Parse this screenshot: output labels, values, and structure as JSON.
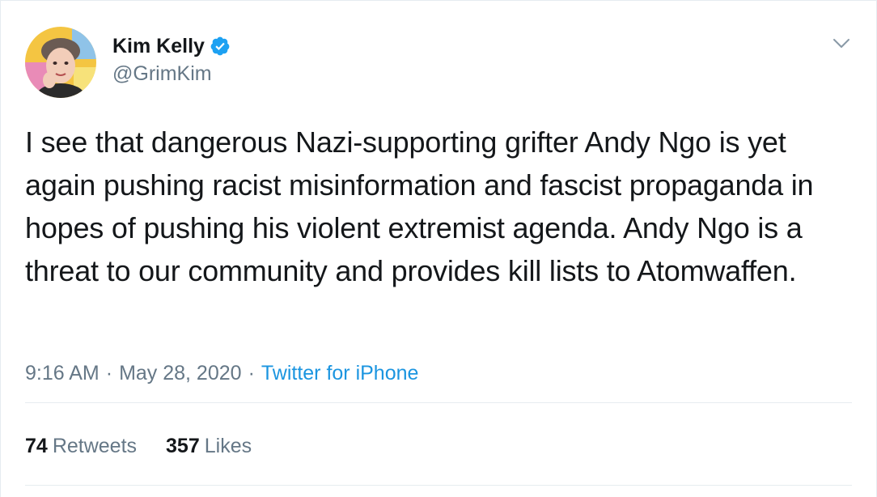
{
  "author": {
    "display_name": "Kim Kelly",
    "handle": "@GrimKim",
    "verified": true,
    "avatar_icon": "user-avatar-photo",
    "verified_icon": "verified-badge-icon"
  },
  "tweet": {
    "text": "I see that dangerous Nazi-supporting grifter Andy Ngo is yet again pushing racist misinformation and fascist propaganda in hopes of pushing his violent extremist agenda. Andy Ngo is a threat to our community and provides kill lists to Atomwaffen."
  },
  "meta": {
    "time": "9:16 AM",
    "separator": "·",
    "date": "May 28, 2020",
    "source": "Twitter for iPhone"
  },
  "stats": {
    "retweets_count": "74",
    "retweets_label": "Retweets",
    "likes_count": "357",
    "likes_label": "Likes"
  },
  "menu": {
    "caret_icon": "chevron-down-icon"
  },
  "colors": {
    "accent": "#1da1f2",
    "link": "#1b95e0",
    "secondary_text": "#657786",
    "primary_text": "#14171a",
    "divider": "#e6ecf0"
  }
}
